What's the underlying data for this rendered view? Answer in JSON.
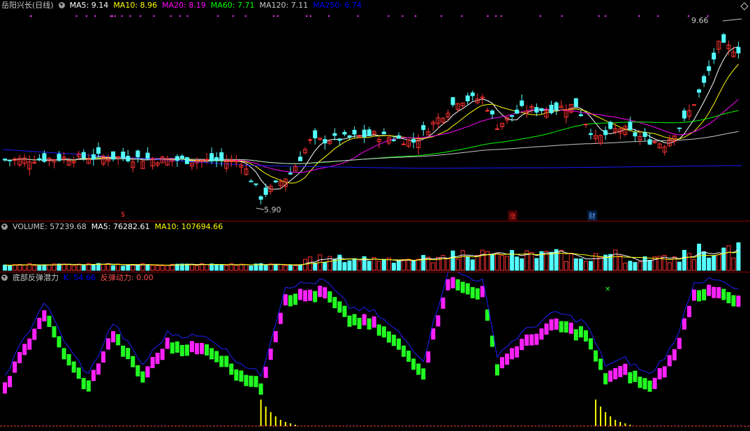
{
  "main": {
    "title": "岳阳兴长(日线)",
    "ma": [
      {
        "label": "MA5: 9.14",
        "color": "#ffffff"
      },
      {
        "label": "MA10: 8.96",
        "color": "#ffff00"
      },
      {
        "label": "MA20: 8.19",
        "color": "#ff00ff"
      },
      {
        "label": "MA60: 7.71",
        "color": "#00ff00"
      },
      {
        "label": "MA120: 7.11",
        "color": "#c8c8c8"
      },
      {
        "label": "MA250: 6.74",
        "color": "#0000ff"
      }
    ],
    "high_label": "9.66",
    "low_label": "5.90",
    "events": [
      {
        "label": "$",
        "color": "#ff3030"
      },
      {
        "label": "涨",
        "color": "#ff3030"
      },
      {
        "label": "财",
        "color": "#60a0ff"
      }
    ]
  },
  "volume": {
    "title": "VOLUME: 57239.68",
    "ma5": "MA5: 76282.61",
    "ma10": "MA10: 107694.66"
  },
  "indicator": {
    "title": "底部反弹潜力",
    "k_label": "K: 54.66",
    "power_label": "反弹动力: 0.00",
    "k_color": "#0000ff",
    "power_color": "#ff5050"
  },
  "colors": {
    "up": "#ff3232",
    "down": "#54ffff",
    "bg": "#000000",
    "grid": "#8b0000"
  }
}
